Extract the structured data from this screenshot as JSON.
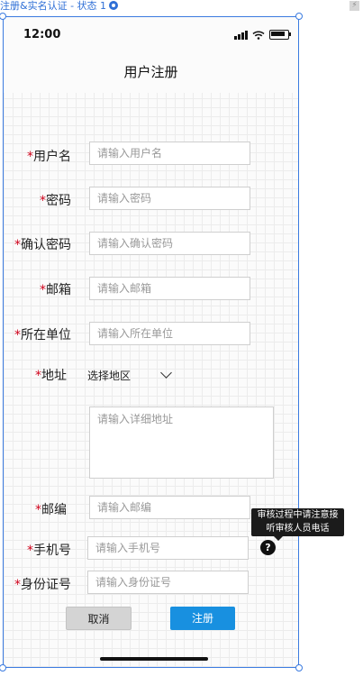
{
  "canvas": {
    "label": "注册&实名认证 - 状态 1"
  },
  "status_bar": {
    "time": "12:00"
  },
  "header": {
    "title": "用户注册"
  },
  "required_mark": "*",
  "form": {
    "username": {
      "label": "用户名",
      "placeholder": "请输入用户名"
    },
    "password": {
      "label": "密码",
      "placeholder": "请输入密码"
    },
    "confirm_password": {
      "label": "确认密码",
      "placeholder": "请输入确认密码"
    },
    "email": {
      "label": "邮箱",
      "placeholder": "请输入邮箱"
    },
    "organization": {
      "label": "所在单位",
      "placeholder": "请输入所在单位"
    },
    "address": {
      "label": "地址",
      "region_select": "选择地区",
      "detail_placeholder": "请输入详细地址"
    },
    "postcode": {
      "label": "邮编",
      "placeholder": "请输入邮编"
    },
    "phone": {
      "label": "手机号",
      "placeholder": "请输入手机号"
    },
    "id_number": {
      "label": "身份证号",
      "placeholder": "请输入身份证号"
    }
  },
  "tooltip": {
    "line1": "审核过程中请注意接",
    "line2": "听审核人员电话"
  },
  "help_icon": {
    "glyph": "?"
  },
  "buttons": {
    "cancel": "取消",
    "submit": "注册"
  },
  "colors": {
    "accent": "#1890e0",
    "required": "#d0021b",
    "frame": "#3b7be0"
  }
}
